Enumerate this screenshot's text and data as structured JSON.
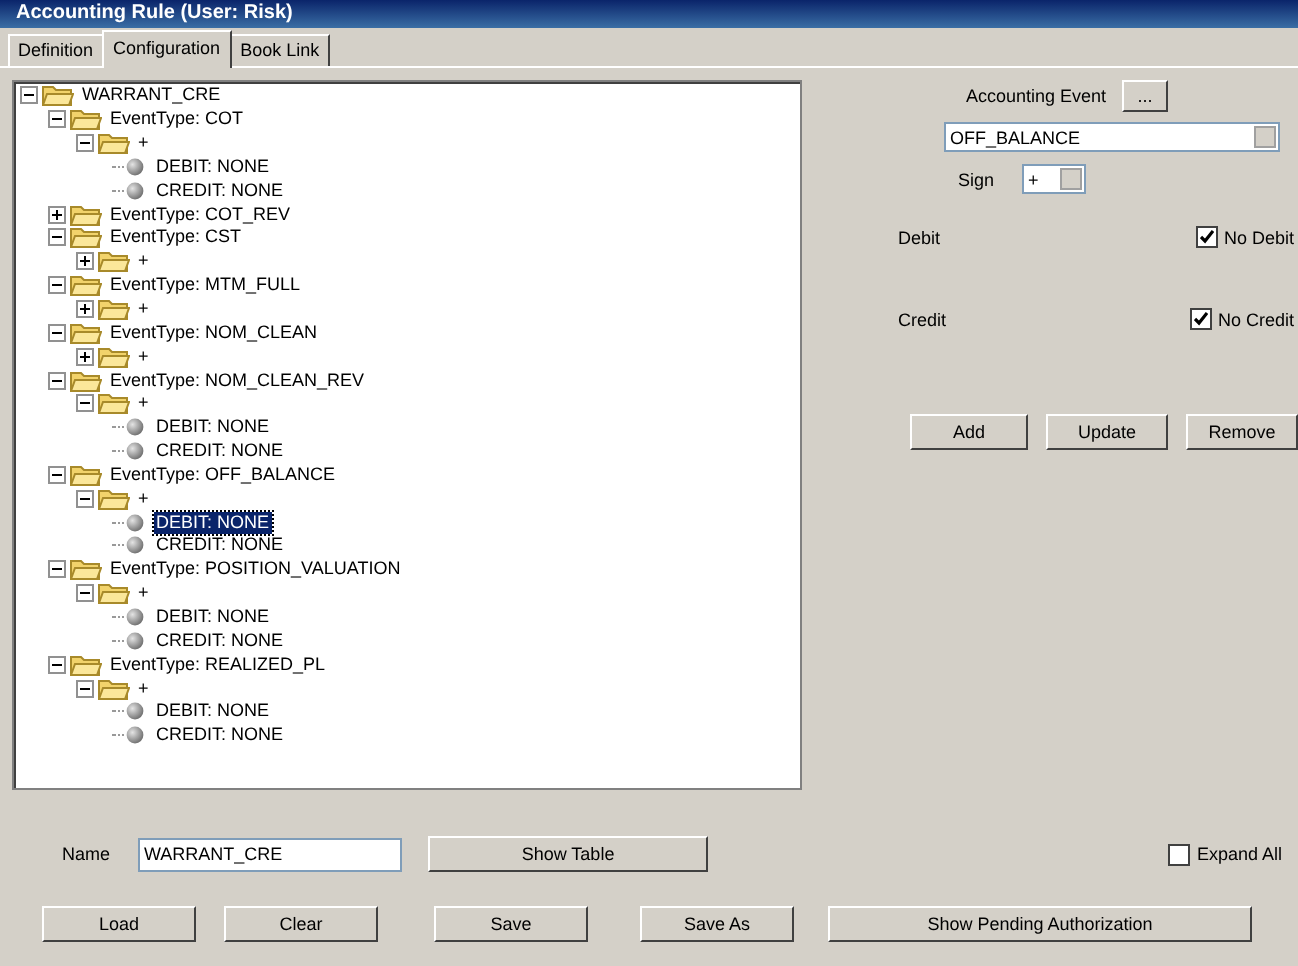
{
  "window": {
    "title": "Accounting Rule (User: Risk)"
  },
  "tabs": [
    {
      "label": "Definition",
      "selected": false
    },
    {
      "label": "Configuration",
      "selected": true
    },
    {
      "label": "Book Link",
      "selected": false
    }
  ],
  "tree": {
    "label": "WARRANT_CRE",
    "kind": "folder",
    "expanded": true,
    "children": [
      {
        "label": "EventType: COT",
        "kind": "folder",
        "expanded": true,
        "children": [
          {
            "label": "+",
            "kind": "folder",
            "expanded": true,
            "children": [
              {
                "label": "DEBIT: NONE",
                "kind": "leaf",
                "selected": false
              },
              {
                "label": "CREDIT: NONE",
                "kind": "leaf",
                "selected": false
              }
            ]
          }
        ]
      },
      {
        "label": "EventType: COT_REV",
        "kind": "folder",
        "expanded": false
      },
      {
        "label": "EventType: CST",
        "kind": "folder",
        "expanded": true,
        "children": [
          {
            "label": "+",
            "kind": "folder",
            "expanded": false
          }
        ]
      },
      {
        "label": "EventType: MTM_FULL",
        "kind": "folder",
        "expanded": true,
        "children": [
          {
            "label": "+",
            "kind": "folder",
            "expanded": false
          }
        ]
      },
      {
        "label": "EventType: NOM_CLEAN",
        "kind": "folder",
        "expanded": true,
        "children": [
          {
            "label": "+",
            "kind": "folder",
            "expanded": false
          }
        ]
      },
      {
        "label": "EventType: NOM_CLEAN_REV",
        "kind": "folder",
        "expanded": true,
        "children": [
          {
            "label": "+",
            "kind": "folder",
            "expanded": true,
            "children": [
              {
                "label": "DEBIT: NONE",
                "kind": "leaf",
                "selected": false
              },
              {
                "label": "CREDIT: NONE",
                "kind": "leaf",
                "selected": false
              }
            ]
          }
        ]
      },
      {
        "label": "EventType: OFF_BALANCE",
        "kind": "folder",
        "expanded": true,
        "children": [
          {
            "label": "+",
            "kind": "folder",
            "expanded": true,
            "children": [
              {
                "label": "DEBIT: NONE",
                "kind": "leaf",
                "selected": true
              },
              {
                "label": "CREDIT: NONE",
                "kind": "leaf",
                "selected": false
              }
            ]
          }
        ]
      },
      {
        "label": "EventType: POSITION_VALUATION",
        "kind": "folder",
        "expanded": true,
        "children": [
          {
            "label": "+",
            "kind": "folder",
            "expanded": true,
            "children": [
              {
                "label": "DEBIT: NONE",
                "kind": "leaf",
                "selected": false
              },
              {
                "label": "CREDIT: NONE",
                "kind": "leaf",
                "selected": false
              }
            ]
          }
        ]
      },
      {
        "label": "EventType: REALIZED_PL",
        "kind": "folder",
        "expanded": true,
        "children": [
          {
            "label": "+",
            "kind": "folder",
            "expanded": true,
            "children": [
              {
                "label": "DEBIT: NONE",
                "kind": "leaf",
                "selected": false
              },
              {
                "label": "CREDIT: NONE",
                "kind": "leaf",
                "selected": false
              }
            ]
          }
        ]
      }
    ]
  },
  "accounting_event": {
    "label": "Accounting Event",
    "button": "...",
    "value": "OFF_BALANCE"
  },
  "sign": {
    "label": "Sign",
    "value": "+"
  },
  "debit": {
    "label": "Debit",
    "checkbox": {
      "label": "No Debit",
      "checked": true
    }
  },
  "credit": {
    "label": "Credit",
    "checkbox": {
      "label": "No Credit",
      "checked": true
    }
  },
  "action_buttons": [
    "Add",
    "Update",
    "Remove"
  ],
  "name": {
    "label": "Name",
    "value": "WARRANT_CRE"
  },
  "show_table_button": "Show Table",
  "expand_all": {
    "label": "Expand All",
    "checked": false
  },
  "bottom_buttons": [
    "Load",
    "Clear",
    "Save",
    "Save As",
    "Show Pending Authorization"
  ]
}
